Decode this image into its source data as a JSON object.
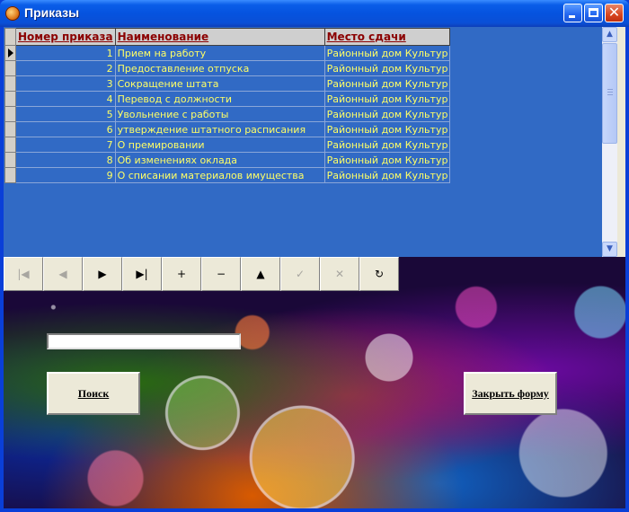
{
  "window": {
    "title": "Приказы"
  },
  "grid": {
    "columns": [
      "Номер приказа",
      "Наименование",
      "Место  сдачи"
    ],
    "rows": [
      {
        "num": "1",
        "name": "Прием на работу",
        "place": "Районный дом Культур"
      },
      {
        "num": "2",
        "name": "Предоставление отпуска",
        "place": "Районный дом Культур"
      },
      {
        "num": "3",
        "name": "Сокращение штата",
        "place": "Районный дом Культур"
      },
      {
        "num": "4",
        "name": "Перевод с должности",
        "place": "Районный дом Культур"
      },
      {
        "num": "5",
        "name": "Увольнение с работы",
        "place": "Районный дом Культур"
      },
      {
        "num": "6",
        "name": "утверждение штатного расписания",
        "place": "Районный дом Культур"
      },
      {
        "num": "7",
        "name": "О премировании",
        "place": "Районный дом Культур"
      },
      {
        "num": "8",
        "name": "Об изменениях оклада",
        "place": "Районный дом Культур"
      },
      {
        "num": "9",
        "name": "О списании материалов имущества",
        "place": "Районный дом Культур"
      }
    ]
  },
  "navigator": {
    "buttons": [
      {
        "name": "first-record-button",
        "glyph": "|◀",
        "enabled": false
      },
      {
        "name": "prior-record-button",
        "glyph": "◀",
        "enabled": false
      },
      {
        "name": "next-record-button",
        "glyph": "▶",
        "enabled": true
      },
      {
        "name": "last-record-button",
        "glyph": "▶|",
        "enabled": true
      },
      {
        "name": "insert-record-button",
        "glyph": "+",
        "enabled": true
      },
      {
        "name": "delete-record-button",
        "glyph": "−",
        "enabled": true
      },
      {
        "name": "edit-record-button",
        "glyph": "▲",
        "enabled": true
      },
      {
        "name": "post-record-button",
        "glyph": "✓",
        "enabled": false
      },
      {
        "name": "cancel-record-button",
        "glyph": "✕",
        "enabled": false
      },
      {
        "name": "refresh-button",
        "glyph": "↻",
        "enabled": true
      }
    ]
  },
  "search": {
    "value": "",
    "button_label": "Поиск"
  },
  "close_button_label": "Закрыть форму",
  "colors": {
    "grid_bg": "#316ac5",
    "cell_text": "#ffff66",
    "header_text": "#8b0000"
  }
}
